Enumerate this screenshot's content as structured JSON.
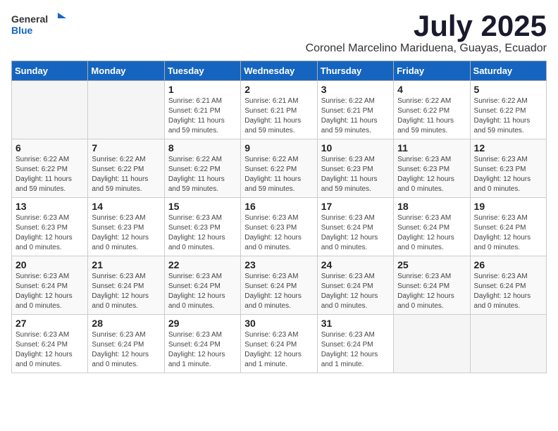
{
  "header": {
    "logo_general": "General",
    "logo_blue": "Blue",
    "month_title": "July 2025",
    "location": "Coronel Marcelino Mariduena, Guayas, Ecuador"
  },
  "weekdays": [
    "Sunday",
    "Monday",
    "Tuesday",
    "Wednesday",
    "Thursday",
    "Friday",
    "Saturday"
  ],
  "weeks": [
    [
      {
        "day": "",
        "info": ""
      },
      {
        "day": "",
        "info": ""
      },
      {
        "day": "1",
        "info": "Sunrise: 6:21 AM\nSunset: 6:21 PM\nDaylight: 11 hours and 59 minutes."
      },
      {
        "day": "2",
        "info": "Sunrise: 6:21 AM\nSunset: 6:21 PM\nDaylight: 11 hours and 59 minutes."
      },
      {
        "day": "3",
        "info": "Sunrise: 6:22 AM\nSunset: 6:21 PM\nDaylight: 11 hours and 59 minutes."
      },
      {
        "day": "4",
        "info": "Sunrise: 6:22 AM\nSunset: 6:22 PM\nDaylight: 11 hours and 59 minutes."
      },
      {
        "day": "5",
        "info": "Sunrise: 6:22 AM\nSunset: 6:22 PM\nDaylight: 11 hours and 59 minutes."
      }
    ],
    [
      {
        "day": "6",
        "info": "Sunrise: 6:22 AM\nSunset: 6:22 PM\nDaylight: 11 hours and 59 minutes."
      },
      {
        "day": "7",
        "info": "Sunrise: 6:22 AM\nSunset: 6:22 PM\nDaylight: 11 hours and 59 minutes."
      },
      {
        "day": "8",
        "info": "Sunrise: 6:22 AM\nSunset: 6:22 PM\nDaylight: 11 hours and 59 minutes."
      },
      {
        "day": "9",
        "info": "Sunrise: 6:22 AM\nSunset: 6:22 PM\nDaylight: 11 hours and 59 minutes."
      },
      {
        "day": "10",
        "info": "Sunrise: 6:23 AM\nSunset: 6:23 PM\nDaylight: 11 hours and 59 minutes."
      },
      {
        "day": "11",
        "info": "Sunrise: 6:23 AM\nSunset: 6:23 PM\nDaylight: 12 hours and 0 minutes."
      },
      {
        "day": "12",
        "info": "Sunrise: 6:23 AM\nSunset: 6:23 PM\nDaylight: 12 hours and 0 minutes."
      }
    ],
    [
      {
        "day": "13",
        "info": "Sunrise: 6:23 AM\nSunset: 6:23 PM\nDaylight: 12 hours and 0 minutes."
      },
      {
        "day": "14",
        "info": "Sunrise: 6:23 AM\nSunset: 6:23 PM\nDaylight: 12 hours and 0 minutes."
      },
      {
        "day": "15",
        "info": "Sunrise: 6:23 AM\nSunset: 6:23 PM\nDaylight: 12 hours and 0 minutes."
      },
      {
        "day": "16",
        "info": "Sunrise: 6:23 AM\nSunset: 6:23 PM\nDaylight: 12 hours and 0 minutes."
      },
      {
        "day": "17",
        "info": "Sunrise: 6:23 AM\nSunset: 6:24 PM\nDaylight: 12 hours and 0 minutes."
      },
      {
        "day": "18",
        "info": "Sunrise: 6:23 AM\nSunset: 6:24 PM\nDaylight: 12 hours and 0 minutes."
      },
      {
        "day": "19",
        "info": "Sunrise: 6:23 AM\nSunset: 6:24 PM\nDaylight: 12 hours and 0 minutes."
      }
    ],
    [
      {
        "day": "20",
        "info": "Sunrise: 6:23 AM\nSunset: 6:24 PM\nDaylight: 12 hours and 0 minutes."
      },
      {
        "day": "21",
        "info": "Sunrise: 6:23 AM\nSunset: 6:24 PM\nDaylight: 12 hours and 0 minutes."
      },
      {
        "day": "22",
        "info": "Sunrise: 6:23 AM\nSunset: 6:24 PM\nDaylight: 12 hours and 0 minutes."
      },
      {
        "day": "23",
        "info": "Sunrise: 6:23 AM\nSunset: 6:24 PM\nDaylight: 12 hours and 0 minutes."
      },
      {
        "day": "24",
        "info": "Sunrise: 6:23 AM\nSunset: 6:24 PM\nDaylight: 12 hours and 0 minutes."
      },
      {
        "day": "25",
        "info": "Sunrise: 6:23 AM\nSunset: 6:24 PM\nDaylight: 12 hours and 0 minutes."
      },
      {
        "day": "26",
        "info": "Sunrise: 6:23 AM\nSunset: 6:24 PM\nDaylight: 12 hours and 0 minutes."
      }
    ],
    [
      {
        "day": "27",
        "info": "Sunrise: 6:23 AM\nSunset: 6:24 PM\nDaylight: 12 hours and 0 minutes."
      },
      {
        "day": "28",
        "info": "Sunrise: 6:23 AM\nSunset: 6:24 PM\nDaylight: 12 hours and 0 minutes."
      },
      {
        "day": "29",
        "info": "Sunrise: 6:23 AM\nSunset: 6:24 PM\nDaylight: 12 hours and 1 minute."
      },
      {
        "day": "30",
        "info": "Sunrise: 6:23 AM\nSunset: 6:24 PM\nDaylight: 12 hours and 1 minute."
      },
      {
        "day": "31",
        "info": "Sunrise: 6:23 AM\nSunset: 6:24 PM\nDaylight: 12 hours and 1 minute."
      },
      {
        "day": "",
        "info": ""
      },
      {
        "day": "",
        "info": ""
      }
    ]
  ]
}
